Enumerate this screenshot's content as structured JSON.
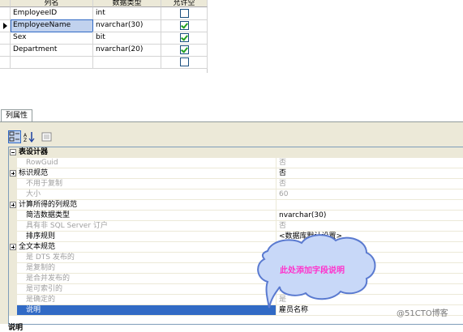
{
  "grid": {
    "headers": [
      "列名",
      "数据类型",
      "允许空"
    ],
    "rows": [
      {
        "name": "EmployeeID",
        "type": "int",
        "allow_null": false,
        "current": false,
        "name_selected": false
      },
      {
        "name": "EmployeeName",
        "type": "nvarchar(30)",
        "allow_null": true,
        "current": true,
        "name_selected": true
      },
      {
        "name": "Sex",
        "type": "bit",
        "allow_null": true,
        "current": false,
        "name_selected": false
      },
      {
        "name": "Department",
        "type": "nvarchar(20)",
        "allow_null": true,
        "current": false,
        "name_selected": false
      },
      {
        "name": "",
        "type": "",
        "allow_null": false,
        "current": false,
        "name_selected": false
      }
    ]
  },
  "panel": {
    "tab_label": "列属性",
    "toolbar": {
      "categorized_icon": "categorized-icon",
      "alphabetical_icon": "sort-alpha-icon",
      "pages_icon": "property-pages-icon"
    },
    "properties": [
      {
        "kind": "cat",
        "name": "表设计器",
        "value": "",
        "expander": "minus"
      },
      {
        "kind": "sub",
        "name": "RowGuid",
        "value": "否",
        "dim": true
      },
      {
        "kind": "subexp",
        "name": "标识规范",
        "value": "否",
        "dim": false,
        "expander": "plus"
      },
      {
        "kind": "sub",
        "name": "不用于复制",
        "value": "否",
        "dim": true
      },
      {
        "kind": "sub",
        "name": "大小",
        "value": "60",
        "dim": true
      },
      {
        "kind": "subexp",
        "name": "计算所得的列规范",
        "value": "",
        "dim": false,
        "expander": "plus"
      },
      {
        "kind": "sub",
        "name": "简洁数据类型",
        "value": "nvarchar(30)",
        "dim": false
      },
      {
        "kind": "sub",
        "name": "具有非 SQL Server 订户",
        "value": "否",
        "dim": true
      },
      {
        "kind": "sub",
        "name": "排序规则",
        "value": "<数据库默认设置>",
        "dim": false
      },
      {
        "kind": "subexp",
        "name": "全文本规范",
        "value": "否",
        "dim": false,
        "expander": "plus"
      },
      {
        "kind": "sub",
        "name": "是 DTS 发布的",
        "value": "否",
        "dim": true
      },
      {
        "kind": "sub",
        "name": "是复制的",
        "value": "否",
        "dim": true
      },
      {
        "kind": "sub",
        "name": "是合并发布的",
        "value": "否",
        "dim": true
      },
      {
        "kind": "sub",
        "name": "是可索引的",
        "value": "是",
        "dim": true
      },
      {
        "kind": "sub",
        "name": "是确定的",
        "value": "是",
        "dim": true
      },
      {
        "kind": "selected",
        "name": "说明",
        "value": "雇员名称",
        "dim": false
      }
    ],
    "bottom_label": "说明"
  },
  "callout": {
    "text": "此处添加字段说明",
    "fill": "#c8d8f8",
    "stroke": "#5a7ad0",
    "text_color": "#ff33cc"
  },
  "watermark": "@51CTO博客"
}
